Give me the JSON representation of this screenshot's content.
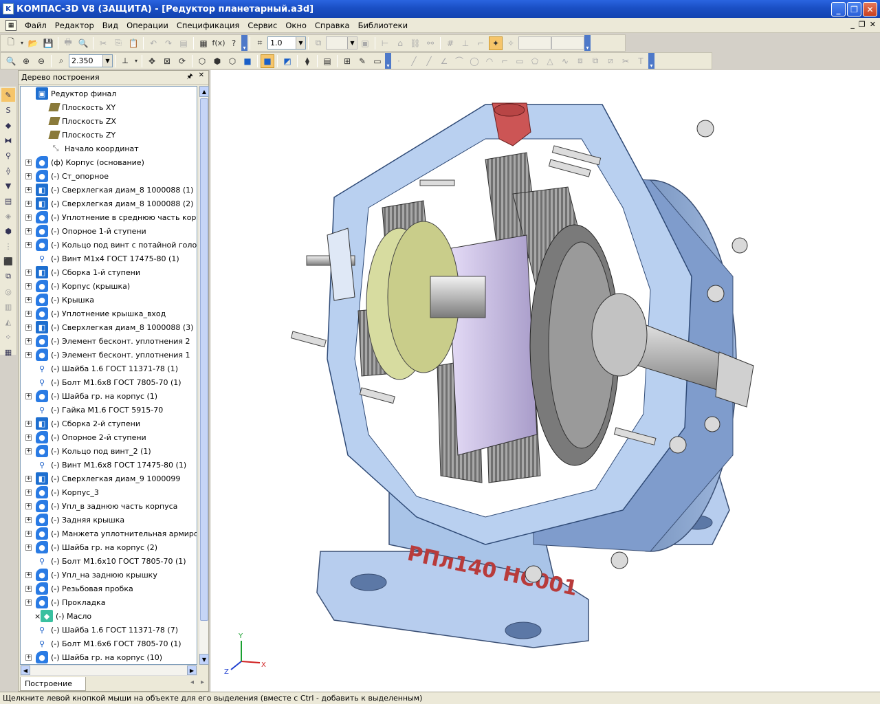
{
  "window": {
    "title": "КОМПАС-3D V8 (ЗАЩИТА) - [Редуктор планетарный.a3d]"
  },
  "menu": [
    "Файл",
    "Редактор",
    "Вид",
    "Операции",
    "Спецификация",
    "Сервис",
    "Окно",
    "Справка",
    "Библиотеки"
  ],
  "toolbar": {
    "step_value": "1.0",
    "zoom_value": "2.350"
  },
  "tree_panel": {
    "title": "Дерево построения",
    "tab_label": "Построение",
    "items": [
      {
        "label": "Редуктор финал",
        "icon": "assembly-root-icon",
        "expand": false
      },
      {
        "label": "Плоскость XY",
        "icon": "plane-icon",
        "expand": false
      },
      {
        "label": "Плоскость ZX",
        "icon": "plane-icon",
        "expand": false
      },
      {
        "label": "Плоскость ZY",
        "icon": "plane-icon",
        "expand": false
      },
      {
        "label": "Начало координат",
        "icon": "origin-icon",
        "expand": false
      },
      {
        "label": "(ф) Корпус (основание)",
        "icon": "part-icon",
        "expand": true
      },
      {
        "label": "(-) Ст_опорное",
        "icon": "part-icon",
        "expand": true
      },
      {
        "label": "(-) Сверхлегкая диам_8 1000088 (1)",
        "icon": "assembly-icon",
        "expand": true
      },
      {
        "label": "(-) Сверхлегкая диам_8 1000088 (2)",
        "icon": "assembly-icon",
        "expand": true
      },
      {
        "label": "(-) Уплотнение в среднюю часть корпу",
        "icon": "part-icon",
        "expand": true
      },
      {
        "label": "(-) Опорное 1-й ступени",
        "icon": "part-icon",
        "expand": true
      },
      {
        "label": "(-) Кольцо под винт с потайной головкс",
        "icon": "part-icon",
        "expand": true
      },
      {
        "label": "(-) Винт М1х4 ГОСТ 17475-80 (1)",
        "icon": "standard-part-icon",
        "expand": false
      },
      {
        "label": "(-) Сборка 1-й ступени",
        "icon": "assembly-icon",
        "expand": true
      },
      {
        "label": "(-) Корпус (крышка)",
        "icon": "part-icon",
        "expand": true
      },
      {
        "label": "(-) Крышка",
        "icon": "part-icon",
        "expand": true
      },
      {
        "label": "(-) Уплотнение крышка_вход",
        "icon": "part-icon",
        "expand": true
      },
      {
        "label": "(-) Сверхлегкая диам_8 1000088 (3)",
        "icon": "assembly-icon",
        "expand": true
      },
      {
        "label": "(-) Элемент бесконт. уплотнения 2",
        "icon": "part-icon",
        "expand": true
      },
      {
        "label": "(-) Элемент бесконт. уплотнения 1",
        "icon": "part-icon",
        "expand": true
      },
      {
        "label": "(-) Шайба 1.6 ГОСТ 11371-78 (1)",
        "icon": "standard-part-icon",
        "expand": false
      },
      {
        "label": "(-) Болт М1.6х8 ГОСТ 7805-70 (1)",
        "icon": "standard-part-icon",
        "expand": false
      },
      {
        "label": "(-) Шайба гр. на корпус (1)",
        "icon": "part-icon",
        "expand": true
      },
      {
        "label": "(-) Гайка М1.6 ГОСТ 5915-70",
        "icon": "standard-part-icon",
        "expand": false
      },
      {
        "label": "(-) Сборка 2-й ступени",
        "icon": "assembly-icon",
        "expand": true
      },
      {
        "label": "(-) Опорное 2-й ступени",
        "icon": "part-icon",
        "expand": true
      },
      {
        "label": "(-) Кольцо под винт_2 (1)",
        "icon": "part-icon",
        "expand": true
      },
      {
        "label": "(-) Винт М1.6х8 ГОСТ 17475-80 (1)",
        "icon": "standard-part-icon",
        "expand": false
      },
      {
        "label": "(-) Сверхлегкая диам_9 1000099",
        "icon": "assembly-icon",
        "expand": true
      },
      {
        "label": "(-) Корпус_3",
        "icon": "part-icon",
        "expand": true
      },
      {
        "label": "(-) Упл_в заднюю часть корпуса",
        "icon": "part-icon",
        "expand": true
      },
      {
        "label": "(-) Задняя крышка",
        "icon": "part-icon",
        "expand": true
      },
      {
        "label": "(-) Манжета уплотнительная армирова",
        "icon": "part-icon",
        "expand": true
      },
      {
        "label": "(-) Шайба гр. на корпус (2)",
        "icon": "part-icon",
        "expand": true
      },
      {
        "label": "(-) Болт М1.6х10 ГОСТ 7805-70 (1)",
        "icon": "standard-part-icon",
        "expand": false
      },
      {
        "label": "(-) Упл_на заднюю крышку",
        "icon": "part-icon",
        "expand": true
      },
      {
        "label": "(-) Резьбовая пробка",
        "icon": "part-icon",
        "expand": true
      },
      {
        "label": "(-) Прокладка",
        "icon": "part-icon",
        "expand": true
      },
      {
        "label": "(-) Масло",
        "icon": "oil-icon",
        "expand": false,
        "marker": "×"
      },
      {
        "label": "(-) Шайба 1.6 ГОСТ 11371-78 (7)",
        "icon": "standard-part-icon",
        "expand": false
      },
      {
        "label": "(-) Болт М1.6х6 ГОСТ 7805-70 (1)",
        "icon": "standard-part-icon",
        "expand": false
      },
      {
        "label": "(-) Шайба гр. на корпус (10)",
        "icon": "part-icon",
        "expand": true
      }
    ]
  },
  "viewport": {
    "model_marking": "РПл140 НС001",
    "axis_labels": {
      "x": "X",
      "y": "Y",
      "z": "Z"
    },
    "colors": {
      "housing": "#a9c4e8",
      "housing_dark": "#5f7fae",
      "section": "#7fa6e0",
      "plug": "#cc5555",
      "gear": "#9a9a9a",
      "carrier": "#c8bde6",
      "bearing_ring": "#d7dca0"
    }
  },
  "status": {
    "text": "Щелкните левой кнопкой мыши на объекте для его выделения (вместе с Ctrl - добавить к выделенным)"
  }
}
